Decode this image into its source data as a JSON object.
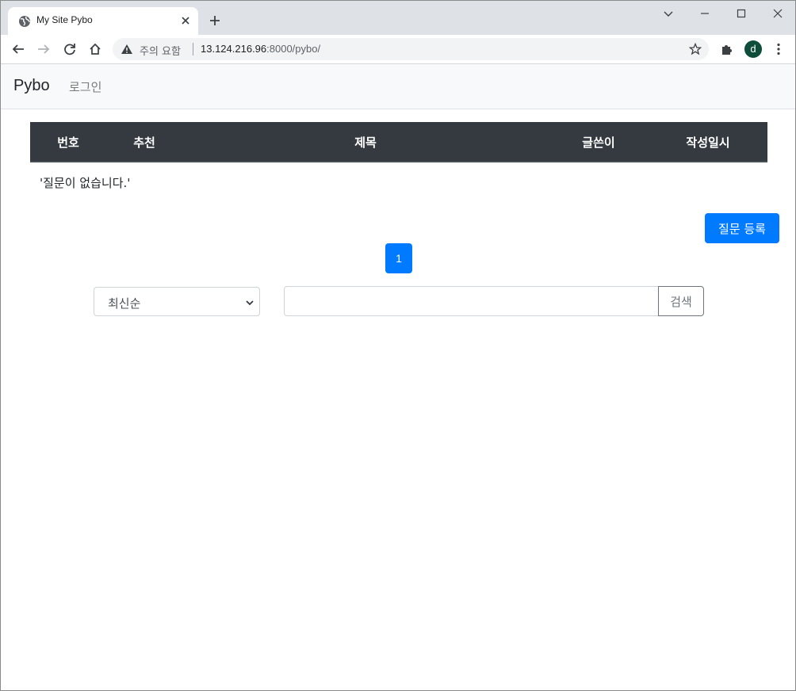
{
  "browser": {
    "tab_title": "My Site Pybo",
    "security_warning": "주의 요함",
    "url_host": "13.124.216.96",
    "url_path": ":8000/pybo/",
    "profile_initial": "d"
  },
  "navbar": {
    "brand": "Pybo",
    "login": "로그인"
  },
  "table": {
    "columns": [
      "번호",
      "추천",
      "제목",
      "글쓴이",
      "작성일시"
    ],
    "empty_message": "'질문이 없습니다.'"
  },
  "actions": {
    "register_question": "질문 등록"
  },
  "pagination": {
    "current_page": "1"
  },
  "search": {
    "sort_selected": "최신순",
    "query_value": "",
    "button_label": "검색"
  },
  "colors": {
    "primary": "#007bff",
    "table_head": "#343a40",
    "navbar_bg": "#f8f9fa"
  }
}
